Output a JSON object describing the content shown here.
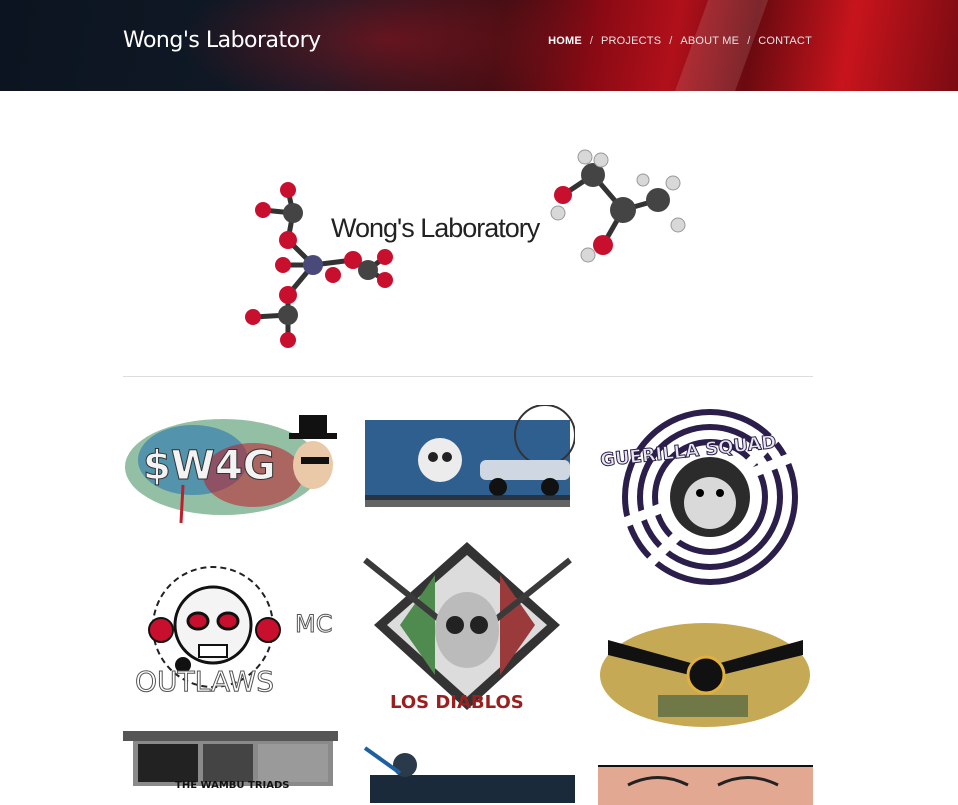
{
  "site": {
    "title": "Wong's Laboratory"
  },
  "nav": {
    "items": [
      {
        "label": "HOME",
        "active": true
      },
      {
        "label": "PROJECTS",
        "active": false
      },
      {
        "label": "ABOUT ME",
        "active": false
      },
      {
        "label": "CONTACT",
        "active": false
      }
    ],
    "separator": "/"
  },
  "logo": {
    "text": "Wong's Laboratory"
  },
  "gallery": {
    "tiles": [
      {
        "text": "$W4G",
        "icon": "graffiti-logo"
      },
      {
        "text": "",
        "icon": "skull-lowrider-art"
      },
      {
        "text": "GUERILLA SQUAD",
        "icon": "gorilla-logo"
      },
      {
        "text": "MC",
        "icon": "skull-logo"
      },
      {
        "text": "OUTLAWS",
        "icon": "skull-logo"
      },
      {
        "text": "LOS DIABLOS",
        "icon": "sugar-skull-logo"
      },
      {
        "text": "",
        "icon": "guns-logo"
      },
      {
        "text": "THE WAMBU TRIADS",
        "icon": "gang-banner"
      },
      {
        "text": "",
        "icon": "movie-art"
      },
      {
        "text": "",
        "icon": "face-art"
      }
    ]
  },
  "colors": {
    "accent_red": "#c8141c",
    "dark_navy": "#0b1420"
  }
}
